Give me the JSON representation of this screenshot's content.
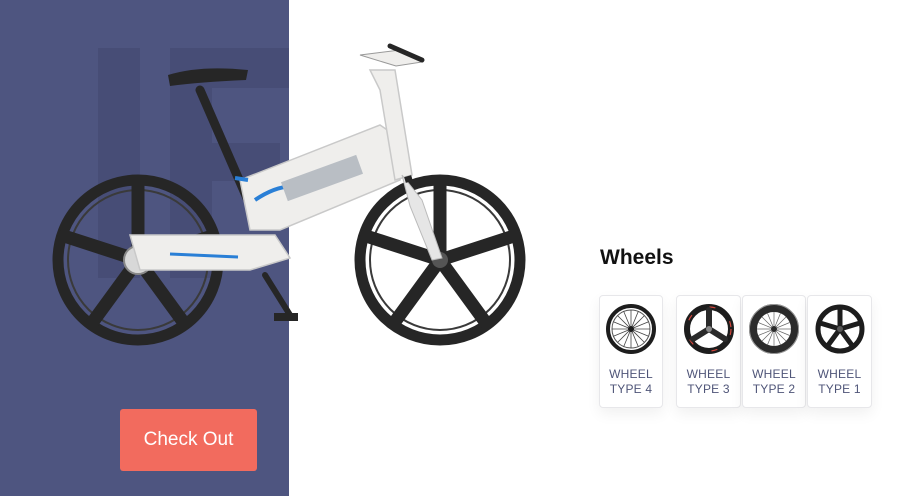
{
  "checkout": {
    "label": "Check Out"
  },
  "options": {
    "title": "Wheels",
    "wheels": [
      {
        "line1": "WHEEL",
        "line2": "TYPE 4",
        "icon": "wheel-type-4-icon"
      },
      {
        "line1": "WHEEL",
        "line2": "TYPE 3",
        "icon": "wheel-type-3-icon"
      },
      {
        "line1": "WHEEL",
        "line2": "TYPE 2",
        "icon": "wheel-type-2-icon"
      },
      {
        "line1": "WHEEL",
        "line2": "TYPE 1",
        "icon": "wheel-type-1-icon"
      }
    ]
  },
  "colors": {
    "panel": "#4e5580",
    "accent": "#f26b5e",
    "bike_frame": "#efeeec",
    "bike_accent": "#2a7fd6",
    "tire": "#262626"
  }
}
